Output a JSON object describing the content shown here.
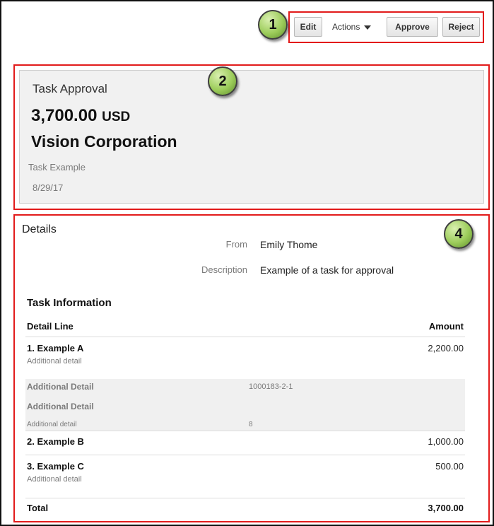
{
  "toolbar": {
    "edit_label": "Edit",
    "actions_label": "Actions",
    "approve_label": "Approve",
    "reject_label": "Reject"
  },
  "callouts": {
    "c1": "1",
    "c2": "2",
    "c4": "4"
  },
  "header": {
    "task_type": "Task Approval",
    "amount": "3,700.00",
    "currency": "USD",
    "company": "Vision Corporation",
    "task_name": "Task Example",
    "date": "8/29/17"
  },
  "details": {
    "title": "Details",
    "from_label": "From",
    "from_value": "Emily Thome",
    "description_label": "Description",
    "description_value": "Example of a task for approval"
  },
  "task_info": {
    "title": "Task Information",
    "col_detail": "Detail Line",
    "col_amount": "Amount",
    "lines": [
      {
        "name": "1. Example A",
        "sub": "Additional detail",
        "amount": "2,200.00"
      },
      {
        "name": "2. Example B",
        "amount": "1,000.00"
      },
      {
        "name": "3. Example C",
        "sub": "Additional detail",
        "amount": "500.00"
      }
    ],
    "extra": [
      {
        "label": "Additional Detail",
        "value": "1000183-2-1"
      },
      {
        "label": "Additional Detail",
        "value": ""
      },
      {
        "label": "Additional detail",
        "value": "8"
      }
    ],
    "total_label": "Total",
    "total_amount": "3,700.00"
  },
  "colors": {
    "highlight": "#e21b1b",
    "callout": "#9ccc5a"
  }
}
